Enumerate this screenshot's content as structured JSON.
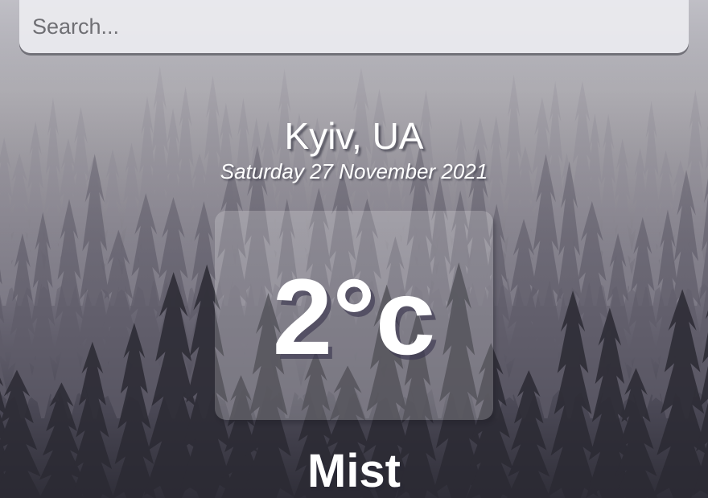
{
  "search": {
    "placeholder": "Search...",
    "value": ""
  },
  "location": {
    "city": "Kyiv, UA",
    "date": "Saturday 27 November 2021"
  },
  "weather": {
    "temperature": "2°c",
    "condition": "Mist"
  },
  "colors": {
    "text": "#ffffff",
    "card": "rgba(255,255,255,0.2)",
    "search_background": "#e9e9ee"
  }
}
